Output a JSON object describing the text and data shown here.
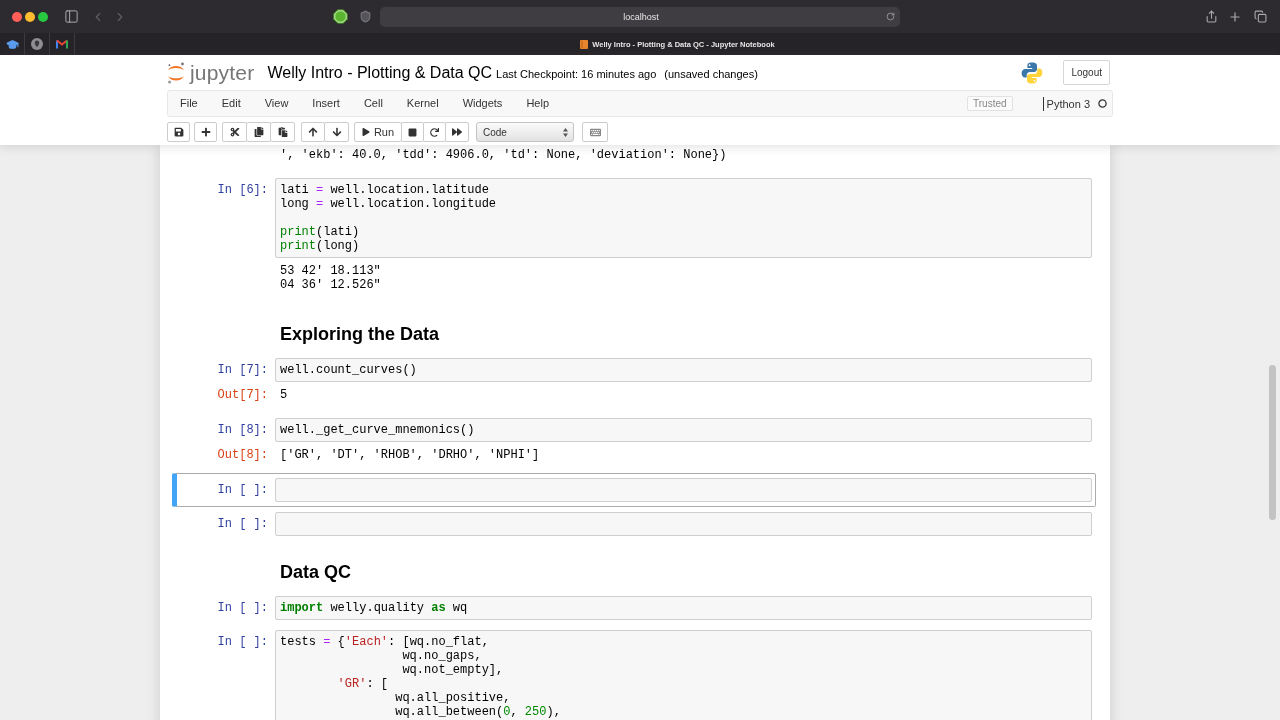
{
  "browser": {
    "address": "localhost",
    "tab_title": "Welly Intro - Plotting & Data QC - Jupyter Notebook"
  },
  "header": {
    "logo_text": "jupyter",
    "title": "Welly Intro - Plotting & Data QC",
    "checkpoint": "Last Checkpoint: 16 minutes ago",
    "unsaved": "(unsaved changes)",
    "logout": "Logout"
  },
  "menu": [
    "File",
    "Edit",
    "View",
    "Insert",
    "Cell",
    "Kernel",
    "Widgets",
    "Help"
  ],
  "status": {
    "trusted": "Trusted",
    "kernel": "Python 3",
    "kernel_busy": false
  },
  "toolbar": {
    "run_label": "Run",
    "cell_type": "Code"
  },
  "top_output": [
    "', 'ekb': 40.0, 'tdd': 4906.0, 'td': None, 'deviation': None})"
  ],
  "cells": [
    {
      "kind": "code",
      "prompt": "In [6]:",
      "selected": false,
      "lines": [
        {
          "kind": "code",
          "tokens": [
            {
              "text": "lati ",
              "kind": "plain"
            },
            {
              "text": "=",
              "kind": "operator"
            },
            {
              "text": " well.location.latitude",
              "kind": "plain"
            }
          ]
        },
        {
          "kind": "code",
          "tokens": [
            {
              "text": "long ",
              "kind": "plain"
            },
            {
              "text": "=",
              "kind": "operator"
            },
            {
              "text": " well.location.longitude",
              "kind": "plain"
            }
          ]
        },
        {
          "kind": "blank"
        },
        {
          "kind": "code",
          "tokens": [
            {
              "text": "print",
              "kind": "builtin"
            },
            {
              "text": "(lati)",
              "kind": "plain"
            }
          ]
        },
        {
          "kind": "code",
          "tokens": [
            {
              "text": "print",
              "kind": "builtin"
            },
            {
              "text": "(long)",
              "kind": "plain"
            }
          ]
        }
      ],
      "output": {
        "lines": [
          "53 42' 18.113\"",
          "04 36' 12.526\""
        ]
      }
    },
    {
      "kind": "markdown",
      "heading": "Exploring the Data"
    },
    {
      "kind": "code",
      "prompt": "In [7]:",
      "selected": false,
      "lines": [
        {
          "kind": "code",
          "tokens": [
            {
              "text": "well.count_curves()",
              "kind": "plain"
            }
          ]
        }
      ],
      "output": {
        "prompt": "Out[7]:",
        "lines": [
          "5"
        ]
      }
    },
    {
      "kind": "code",
      "prompt": "In [8]:",
      "selected": false,
      "lines": [
        {
          "kind": "code",
          "tokens": [
            {
              "text": "well._get_curve_mnemonics()",
              "kind": "plain"
            }
          ]
        }
      ],
      "output": {
        "prompt": "Out[8]:",
        "lines": [
          "['GR', 'DT', 'RHOB', 'DRHO', 'NPHI']"
        ]
      }
    },
    {
      "kind": "code",
      "prompt": "In [ ]:",
      "selected": true
    },
    {
      "kind": "code",
      "prompt": "In [ ]:",
      "selected": false
    },
    {
      "kind": "markdown",
      "heading": "Data QC"
    },
    {
      "kind": "code",
      "prompt": "In [ ]:",
      "selected": false,
      "lines": [
        {
          "kind": "code",
          "tokens": [
            {
              "text": "import",
              "kind": "keyword"
            },
            {
              "text": " welly.quality ",
              "kind": "plain"
            },
            {
              "text": "as",
              "kind": "keyword"
            },
            {
              "text": " wq",
              "kind": "plain"
            }
          ]
        }
      ]
    },
    {
      "kind": "code",
      "prompt": "In [ ]:",
      "selected": false,
      "lines": [
        {
          "kind": "code",
          "tokens": [
            {
              "text": "tests ",
              "kind": "plain"
            },
            {
              "text": "=",
              "kind": "operator"
            },
            {
              "text": " {",
              "kind": "plain"
            },
            {
              "text": "'Each'",
              "kind": "string"
            },
            {
              "text": ": [wq.no_flat,",
              "kind": "plain"
            }
          ]
        },
        {
          "kind": "code",
          "tokens": [
            {
              "text": "                 wq.no_gaps,",
              "kind": "plain"
            }
          ]
        },
        {
          "kind": "code",
          "tokens": [
            {
              "text": "                 wq.not_empty],",
              "kind": "plain"
            }
          ]
        },
        {
          "kind": "code",
          "tokens": [
            {
              "text": "        'GR'",
              "kind": "string"
            },
            {
              "text": ": [",
              "kind": "plain"
            }
          ]
        },
        {
          "kind": "code",
          "tokens": [
            {
              "text": "                wq.all_positive,",
              "kind": "plain"
            }
          ]
        },
        {
          "kind": "code",
          "tokens": [
            {
              "text": "                wq.all_between(",
              "kind": "plain"
            },
            {
              "text": "0",
              "kind": "number"
            },
            {
              "text": ", ",
              "kind": "plain"
            },
            {
              "text": "250",
              "kind": "number"
            },
            {
              "text": "),",
              "kind": "plain"
            }
          ]
        }
      ]
    }
  ]
}
